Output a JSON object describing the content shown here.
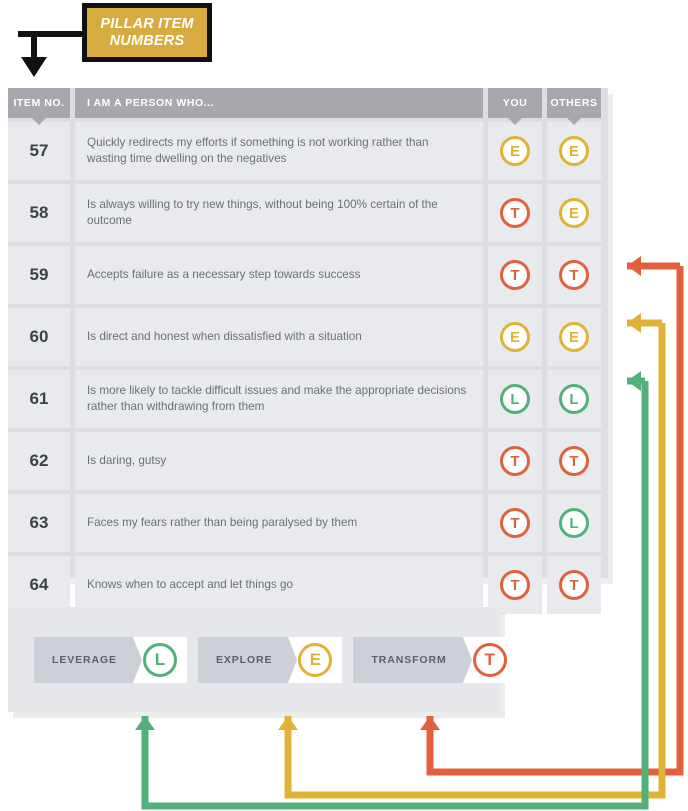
{
  "callout": {
    "text": "PILLAR ITEM NUMBERS",
    "line1": "PILLAR ITEM",
    "line2": "NUMBERS",
    "fill_color": "#d7ab3f",
    "border_color": "#111111"
  },
  "table": {
    "headers": {
      "item_no": "ITEM NO.",
      "statement": "I AM A PERSON WHO...",
      "you": "YOU",
      "others": "OTHERS"
    },
    "rows": [
      {
        "item_no": "57",
        "statement": "Quickly redirects my efforts if something is not working rather than wasting time dwelling on the negatives",
        "you": "E",
        "others": "E"
      },
      {
        "item_no": "58",
        "statement": "Is always willing to try new things, without being 100% certain of the outcome",
        "you": "T",
        "others": "E"
      },
      {
        "item_no": "59",
        "statement": "Accepts failure as a necessary step towards success",
        "you": "T",
        "others": "T"
      },
      {
        "item_no": "60",
        "statement": "Is direct and honest when dissatisfied with a situation",
        "you": "E",
        "others": "E"
      },
      {
        "item_no": "61",
        "statement": "Is more likely to tackle difficult issues and make the appropriate decisions rather than withdrawing from them",
        "you": "L",
        "others": "L"
      },
      {
        "item_no": "62",
        "statement": "Is daring, gutsy",
        "you": "T",
        "others": "T"
      },
      {
        "item_no": "63",
        "statement": "Faces my fears rather than being paralysed by them",
        "you": "T",
        "others": "L"
      },
      {
        "item_no": "64",
        "statement": "Knows when to accept and let things go",
        "you": "T",
        "others": "T"
      }
    ]
  },
  "legend": {
    "items": [
      {
        "label": "LEVERAGE",
        "badge": "L",
        "color": "#52b07a"
      },
      {
        "label": "EXPLORE",
        "badge": "E",
        "color": "#e0b236"
      },
      {
        "label": "TRANSFORM",
        "badge": "T",
        "color": "#e2603c"
      }
    ]
  },
  "connectors": [
    {
      "name": "transform-connector",
      "badge": "T",
      "color": "#e2603c",
      "from_legend": "TRANSFORM",
      "to_row": "59"
    },
    {
      "name": "explore-connector",
      "badge": "E",
      "color": "#e0b236",
      "from_legend": "EXPLORE",
      "to_row": "60"
    },
    {
      "name": "leverage-connector",
      "badge": "L",
      "color": "#52b07a",
      "from_legend": "LEVERAGE",
      "to_row": "61"
    }
  ],
  "colors": {
    "leverage": "#52b07a",
    "explore": "#e0b236",
    "transform": "#e2603c",
    "header_grey": "#a6a8ad",
    "cell_grey": "#e9eaee",
    "panel_grey": "#dcdee1"
  }
}
